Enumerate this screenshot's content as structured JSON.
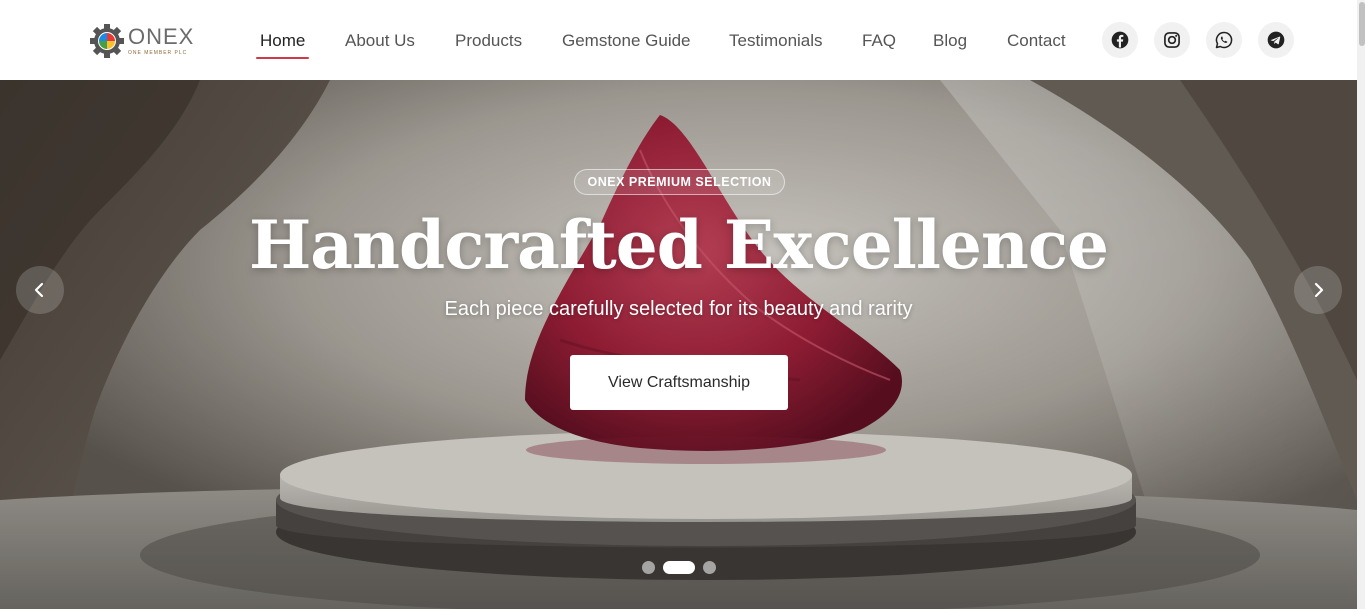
{
  "brand": {
    "name": "ONEX",
    "tagline": "ONE MEMBER PLC"
  },
  "nav": {
    "items": [
      {
        "label": "Home",
        "active": true
      },
      {
        "label": "About Us"
      },
      {
        "label": "Products"
      },
      {
        "label": "Gemstone Guide"
      },
      {
        "label": "Testimonials"
      },
      {
        "label": "FAQ"
      },
      {
        "label": "Blog"
      },
      {
        "label": "Contact"
      }
    ]
  },
  "social": [
    "facebook-icon",
    "instagram-icon",
    "whatsapp-icon",
    "telegram-icon"
  ],
  "hero": {
    "badge": "ONEX PREMIUM SELECTION",
    "title": "Handcrafted Excellence",
    "subtitle": "Each piece carefully selected for its beauty and rarity",
    "cta": "View Craftsmanship",
    "slides_total": 3,
    "active_slide": 2
  },
  "colors": {
    "accent": "#cf3a4a",
    "gem": "#a3243a"
  }
}
